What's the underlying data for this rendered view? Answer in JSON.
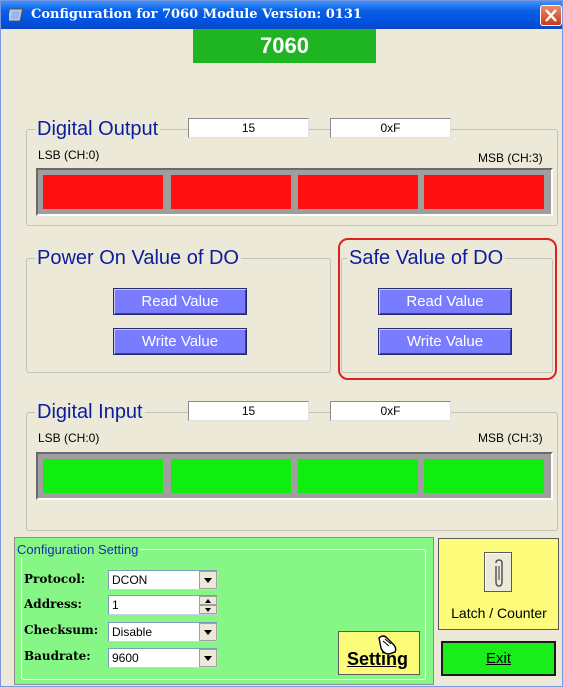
{
  "window": {
    "title": "Configuration for 7060 Module Version: 0131",
    "icon": "app-icon",
    "close_icon": "close-icon"
  },
  "module": {
    "name": "7060",
    "color": "#1fb421"
  },
  "digital_output": {
    "title": "Digital Output",
    "dec_value": "15",
    "hex_value": "0xF",
    "lsb_label": "LSB (CH:0)",
    "msb_label": "MSB (CH:3)",
    "channel_color": "#ff1010",
    "channels": [
      "on",
      "on",
      "on",
      "on"
    ]
  },
  "power_on": {
    "title": "Power On Value of DO",
    "read_label": "Read Value",
    "write_label": "Write Value"
  },
  "safe_value": {
    "title": "Safe Value of DO",
    "read_label": "Read Value",
    "write_label": "Write Value",
    "highlight_color": "#e02020"
  },
  "digital_input": {
    "title": "Digital Input",
    "dec_value": "15",
    "hex_value": "0xF",
    "lsb_label": "LSB (CH:0)",
    "msb_label": "MSB (CH:3)",
    "channel_color": "#10ee10",
    "channels": [
      "on",
      "on",
      "on",
      "on"
    ]
  },
  "config": {
    "title": "Configuration Setting",
    "protocol_label": "Protocol:",
    "protocol_value": "DCON",
    "address_label": "Address:",
    "address_value": "1",
    "checksum_label": "Checksum:",
    "checksum_value": "Disable",
    "baudrate_label": "Baudrate:",
    "baudrate_value": "9600",
    "setting_label": "Setting"
  },
  "side": {
    "latch_label": "Latch / Counter",
    "exit_label": "Exit"
  }
}
